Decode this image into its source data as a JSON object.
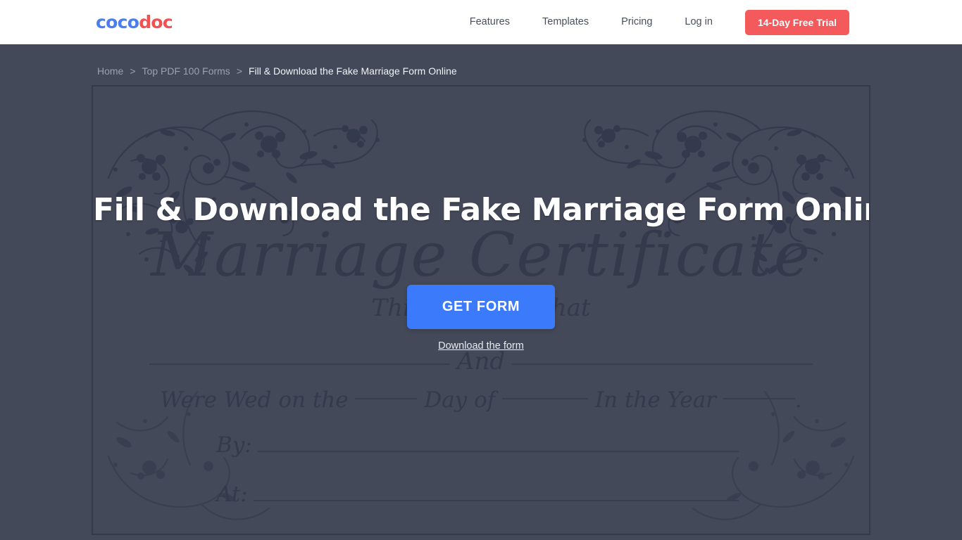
{
  "header": {
    "logo": {
      "part1": "coco",
      "part2": "doc",
      "color1": "#4a7ef0",
      "color2": "#f05252"
    },
    "nav": [
      {
        "label": "Features"
      },
      {
        "label": "Templates"
      },
      {
        "label": "Pricing"
      },
      {
        "label": "Log in"
      }
    ],
    "cta": {
      "label": "14-Day Free Trial",
      "color": "#f4595c"
    }
  },
  "breadcrumb": {
    "items": [
      {
        "label": "Home",
        "current": false
      },
      {
        "label": "Top PDF 100 Forms",
        "current": false
      },
      {
        "label": "Fill & Download the Fake Marriage Form Online",
        "current": true
      }
    ],
    "separator": ">"
  },
  "hero": {
    "title": "Fill & Download the Fake Marriage Form Online",
    "get_form_label": "GET FORM",
    "get_form_color": "#3b7bfb",
    "download_label": "Download the form",
    "background_color": "#434959"
  },
  "certificate": {
    "title": "Marriage Certificate",
    "certifies_text": "This Certifies that",
    "and_text": "And",
    "wed_prefix": "Were Wed on the",
    "wed_mid1": "Day of",
    "wed_mid2": "In the Year",
    "wed_suffix": ".",
    "by_label": "By:",
    "at_label": "At:",
    "ink_color": "#333a4c"
  }
}
